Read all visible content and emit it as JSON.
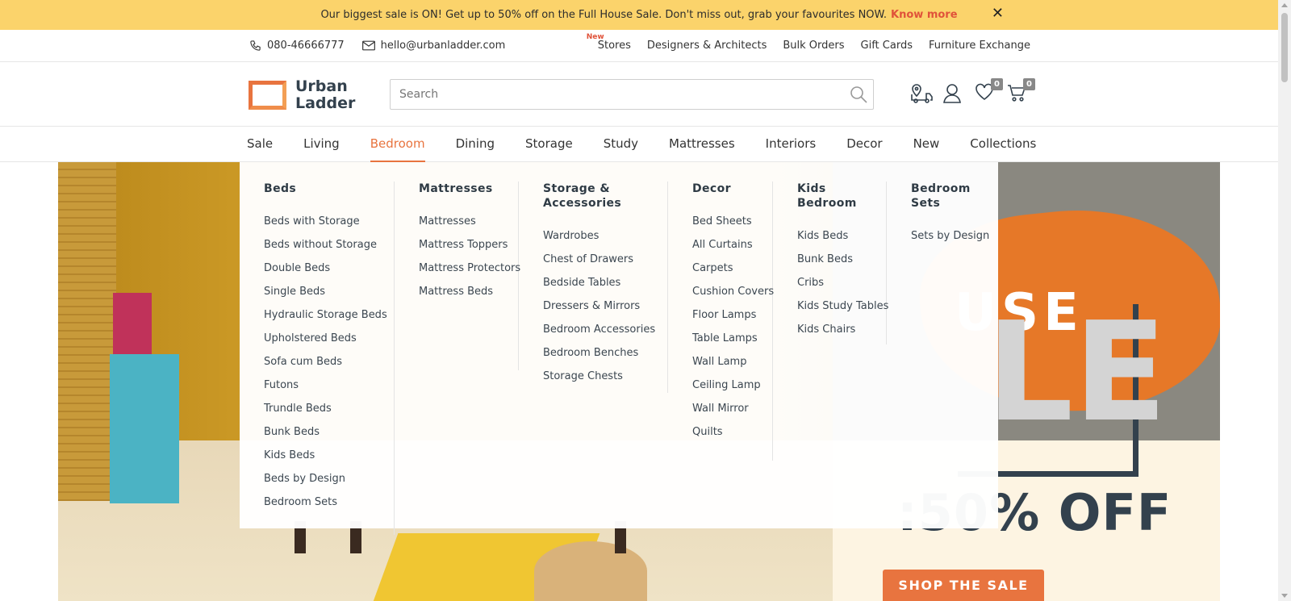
{
  "announcement": {
    "text": "Our biggest sale is ON! Get up to 50% off on the Full House Sale. Don't miss out, grab your favourites NOW.",
    "link": "Know more",
    "close": "✕"
  },
  "contact": {
    "phone": "080-46666777",
    "email": "hello@urbanladder.com"
  },
  "top_links": {
    "new_tag": "New",
    "items": [
      "Stores",
      "Designers & Architects",
      "Bulk Orders",
      "Gift Cards",
      "Furniture Exchange"
    ]
  },
  "logo": {
    "line1": "Urban",
    "line2": "Ladder"
  },
  "search": {
    "placeholder": "Search"
  },
  "header_icons": {
    "track": "track-order-icon",
    "account": "user-icon",
    "wishlist": "heart-icon",
    "wishlist_count": "0",
    "cart": "cart-icon",
    "cart_count": "0"
  },
  "nav": {
    "items": [
      "Sale",
      "Living",
      "Bedroom",
      "Dining",
      "Storage",
      "Study",
      "Mattresses",
      "Interiors",
      "Decor",
      "New",
      "Collections"
    ],
    "active": "Bedroom"
  },
  "mega_menu": {
    "columns": [
      {
        "title": "Beds",
        "links": [
          "Beds with Storage",
          "Beds without Storage",
          "Double Beds",
          "Single Beds",
          "Hydraulic Storage Beds",
          "Upholstered Beds",
          "Sofa cum Beds",
          "Futons",
          "Trundle Beds",
          "Bunk Beds",
          "Kids Beds",
          "Beds by Design",
          "Bedroom Sets"
        ]
      },
      {
        "title": "Mattresses",
        "links": [
          "Mattresses",
          "Mattress Toppers",
          "Mattress Protectors",
          "Mattress Beds"
        ]
      },
      {
        "title": "Storage & Accessories",
        "links": [
          "Wardrobes",
          "Chest of Drawers",
          "Bedside Tables",
          "Dressers & Mirrors",
          "Bedroom Accessories",
          "Bedroom Benches",
          "Storage Chests"
        ]
      },
      {
        "title": "Decor",
        "links": [
          "Bed Sheets",
          "All Curtains",
          "Carpets",
          "Cushion Covers",
          "Floor Lamps",
          "Table Lamps",
          "Wall Lamp",
          "Ceiling Lamp",
          "Wall Mirror",
          "Quilts"
        ]
      },
      {
        "title": "Kids Bedroom",
        "links": [
          "Kids Beds",
          "Bunk Beds",
          "Cribs",
          "Kids Study Tables",
          "Kids Chairs"
        ]
      },
      {
        "title": "Bedroom Sets",
        "links": [
          "Sets by Design"
        ]
      }
    ]
  },
  "hero": {
    "word_partial": "USE",
    "letter": "LE",
    "discount": ":50% OFF",
    "cta": "SHOP THE SALE"
  },
  "colors": {
    "accent": "#e8743f",
    "announce_bg": "#fbd36b",
    "dark": "#33414d"
  }
}
